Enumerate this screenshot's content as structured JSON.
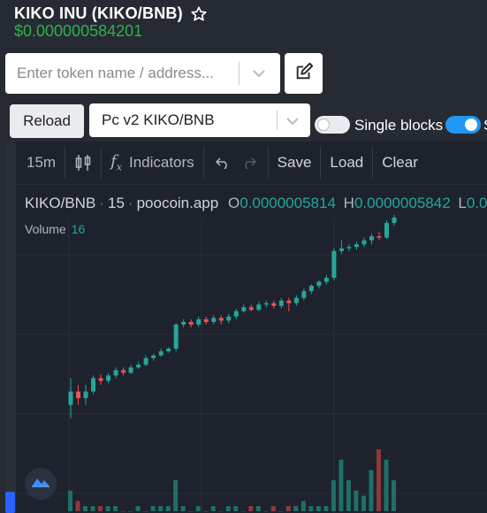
{
  "token": {
    "title": "KIKO INU (KIKO/BNB)",
    "price": "$0.000000584201"
  },
  "search": {
    "placeholder": "Enter token name / address..."
  },
  "controls": {
    "reload_label": "Reload",
    "pair_selected": "Pc v2 KIKO/BNB",
    "single_blocks_label": "Single blocks",
    "single_blocks_on": false,
    "second_toggle_on": true,
    "cut_text": "S"
  },
  "toolbar": {
    "interval": "15m",
    "indicators": "Indicators",
    "save": "Save",
    "load": "Load",
    "clear": "Clear"
  },
  "legend": {
    "symbol": "KIKO/BNB",
    "interval": "15",
    "source": "poocoin.app",
    "o_label": "O",
    "o_value": "0.0000005814",
    "h_label": "H",
    "h_value": "0.0000005842",
    "l_label": "L",
    "l_value": "0.0",
    "volume_label": "Volume",
    "volume_value": "16"
  },
  "colors": {
    "up": "#26a69a",
    "down": "#ef5350",
    "price_green": "#2fb04a",
    "toggle_blue": "#2196f3"
  },
  "chart_data": {
    "type": "candlestick",
    "candles": [
      [
        0.46,
        0.47,
        0.45,
        0.48
      ],
      [
        0.47,
        0.465,
        0.46,
        0.475
      ],
      [
        0.465,
        0.47,
        0.46,
        0.475
      ],
      [
        0.47,
        0.48,
        0.468,
        0.482
      ],
      [
        0.48,
        0.478,
        0.475,
        0.483
      ],
      [
        0.478,
        0.482,
        0.476,
        0.484
      ],
      [
        0.482,
        0.486,
        0.48,
        0.488
      ],
      [
        0.486,
        0.484,
        0.482,
        0.488
      ],
      [
        0.484,
        0.488,
        0.483,
        0.49
      ],
      [
        0.488,
        0.49,
        0.487,
        0.492
      ],
      [
        0.49,
        0.495,
        0.489,
        0.497
      ],
      [
        0.495,
        0.497,
        0.493,
        0.498
      ],
      [
        0.497,
        0.5,
        0.496,
        0.502
      ],
      [
        0.5,
        0.502,
        0.499,
        0.503
      ],
      [
        0.502,
        0.52,
        0.5,
        0.521
      ],
      [
        0.52,
        0.522,
        0.518,
        0.524
      ],
      [
        0.522,
        0.52,
        0.518,
        0.524
      ],
      [
        0.52,
        0.524,
        0.518,
        0.526
      ],
      [
        0.524,
        0.522,
        0.52,
        0.526
      ],
      [
        0.522,
        0.525,
        0.52,
        0.527
      ],
      [
        0.525,
        0.523,
        0.52,
        0.527
      ],
      [
        0.523,
        0.526,
        0.521,
        0.528
      ],
      [
        0.526,
        0.53,
        0.524,
        0.532
      ],
      [
        0.53,
        0.533,
        0.529,
        0.535
      ],
      [
        0.533,
        0.531,
        0.53,
        0.535
      ],
      [
        0.531,
        0.535,
        0.53,
        0.537
      ],
      [
        0.535,
        0.536,
        0.533,
        0.538
      ],
      [
        0.536,
        0.534,
        0.532,
        0.538
      ],
      [
        0.534,
        0.538,
        0.532,
        0.54
      ],
      [
        0.538,
        0.536,
        0.53,
        0.54
      ],
      [
        0.536,
        0.54,
        0.534,
        0.542
      ],
      [
        0.54,
        0.545,
        0.538,
        0.547
      ],
      [
        0.545,
        0.549,
        0.543,
        0.55
      ],
      [
        0.549,
        0.552,
        0.547,
        0.553
      ],
      [
        0.552,
        0.555,
        0.55,
        0.557
      ],
      [
        0.555,
        0.575,
        0.553,
        0.577
      ],
      [
        0.575,
        0.577,
        0.573,
        0.583
      ],
      [
        0.577,
        0.578,
        0.575,
        0.58
      ],
      [
        0.578,
        0.58,
        0.576,
        0.582
      ],
      [
        0.58,
        0.583,
        0.578,
        0.585
      ],
      [
        0.583,
        0.586,
        0.58,
        0.588
      ],
      [
        0.586,
        0.585,
        0.583,
        0.589
      ],
      [
        0.585,
        0.596,
        0.584,
        0.598
      ],
      [
        0.596,
        0.6,
        0.594,
        0.602
      ]
    ],
    "volumes": [
      4,
      2,
      1,
      1,
      1,
      1,
      1,
      0,
      0,
      1,
      0,
      1,
      1,
      1,
      6,
      1,
      0,
      1,
      0,
      1,
      0,
      1,
      1,
      0,
      1,
      1,
      0,
      1,
      0,
      1,
      1,
      2,
      1,
      1,
      1,
      6,
      10,
      6,
      4,
      3,
      8,
      12,
      10,
      6
    ]
  }
}
